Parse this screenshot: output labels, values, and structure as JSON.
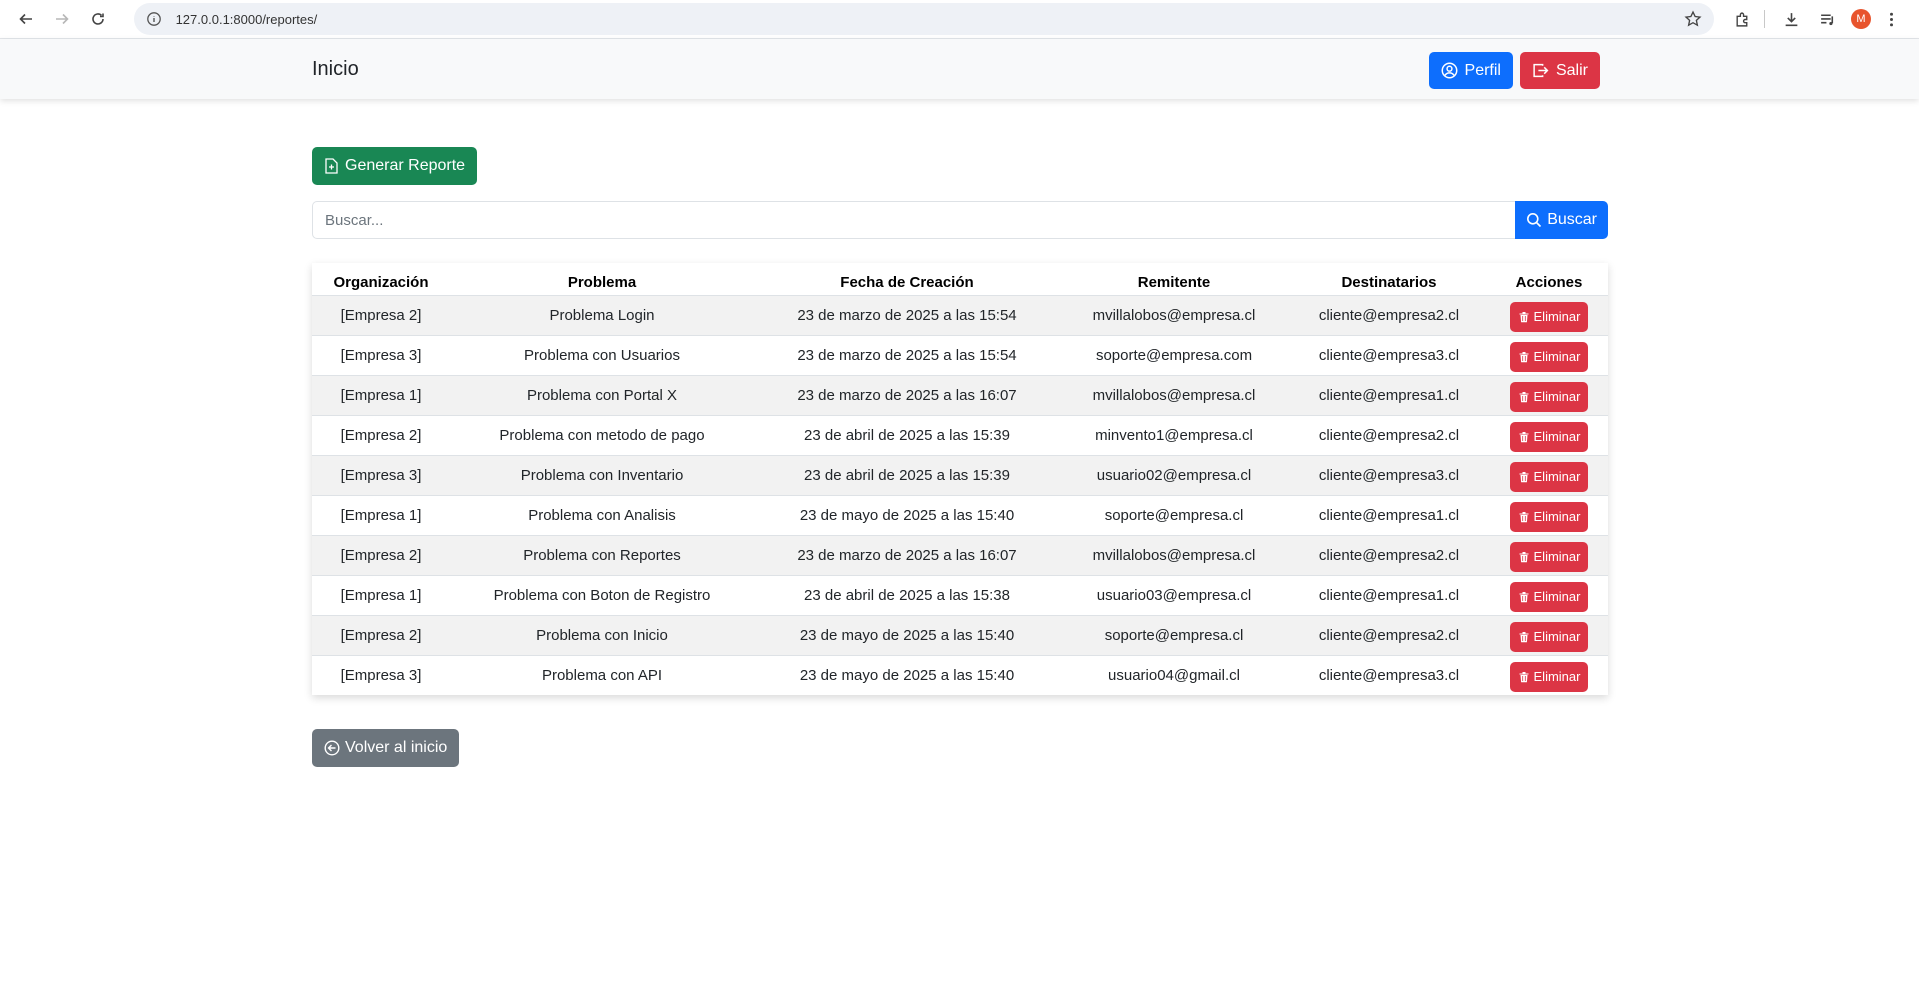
{
  "browser": {
    "url": "127.0.0.1:8000/reportes/",
    "profile_initial": "M"
  },
  "navbar": {
    "brand": "Inicio",
    "perfil_label": "Perfil",
    "salir_label": "Salir"
  },
  "actions": {
    "generar_label": "Generar Reporte",
    "back_label": "Volver al inicio"
  },
  "search": {
    "placeholder": "Buscar...",
    "button_label": "Buscar"
  },
  "table": {
    "headers": {
      "org": "Organización",
      "problema": "Problema",
      "fecha": "Fecha de Creación",
      "remitente": "Remitente",
      "destinatarios": "Destinatarios",
      "acciones": "Acciones"
    },
    "delete_label": "Eliminar",
    "rows": [
      {
        "org": "[Empresa 2]",
        "problema": "Problema Login",
        "fecha": "23 de marzo de 2025 a las 15:54",
        "remitente": "mvillalobos@empresa.cl",
        "destinatarios": "cliente@empresa2.cl"
      },
      {
        "org": "[Empresa 3]",
        "problema": "Problema con Usuarios",
        "fecha": "23 de marzo de 2025 a las 15:54",
        "remitente": "soporte@empresa.com",
        "destinatarios": "cliente@empresa3.cl"
      },
      {
        "org": "[Empresa 1]",
        "problema": "Problema con Portal X",
        "fecha": "23 de marzo de 2025 a las 16:07",
        "remitente": "mvillalobos@empresa.cl",
        "destinatarios": "cliente@empresa1.cl"
      },
      {
        "org": "[Empresa 2]",
        "problema": "Problema con metodo de pago",
        "fecha": "23 de abril de 2025 a las 15:39",
        "remitente": "minvento1@empresa.cl",
        "destinatarios": "cliente@empresa2.cl"
      },
      {
        "org": "[Empresa 3]",
        "problema": "Problema con Inventario",
        "fecha": "23 de abril de 2025 a las 15:39",
        "remitente": "usuario02@empresa.cl",
        "destinatarios": "cliente@empresa3.cl"
      },
      {
        "org": "[Empresa 1]",
        "problema": "Problema con Analisis",
        "fecha": "23 de mayo de 2025 a las 15:40",
        "remitente": "soporte@empresa.cl",
        "destinatarios": "cliente@empresa1.cl"
      },
      {
        "org": "[Empresa 2]",
        "problema": "Problema con Reportes",
        "fecha": "23 de marzo de 2025 a las 16:07",
        "remitente": "mvillalobos@empresa.cl",
        "destinatarios": "cliente@empresa2.cl"
      },
      {
        "org": "[Empresa 1]",
        "problema": "Problema con Boton de Registro",
        "fecha": "23 de abril de 2025 a las 15:38",
        "remitente": "usuario03@empresa.cl",
        "destinatarios": "cliente@empresa1.cl"
      },
      {
        "org": "[Empresa 2]",
        "problema": "Problema con Inicio",
        "fecha": "23 de mayo de 2025 a las 15:40",
        "remitente": "soporte@empresa.cl",
        "destinatarios": "cliente@empresa2.cl"
      },
      {
        "org": "[Empresa 3]",
        "problema": "Problema con API",
        "fecha": "23 de mayo de 2025 a las 15:40",
        "remitente": "usuario04@gmail.cl",
        "destinatarios": "cliente@empresa3.cl"
      }
    ]
  },
  "icons": {
    "perfil": "person-circle-icon",
    "salir": "box-arrow-right-icon",
    "generar": "file-plus-icon",
    "buscar": "search-icon",
    "eliminar": "trash-icon",
    "volver": "arrow-left-circle-icon"
  },
  "colors": {
    "primary": "#0d6efd",
    "danger": "#dc3545",
    "success": "#198754",
    "secondary": "#6c757d"
  }
}
